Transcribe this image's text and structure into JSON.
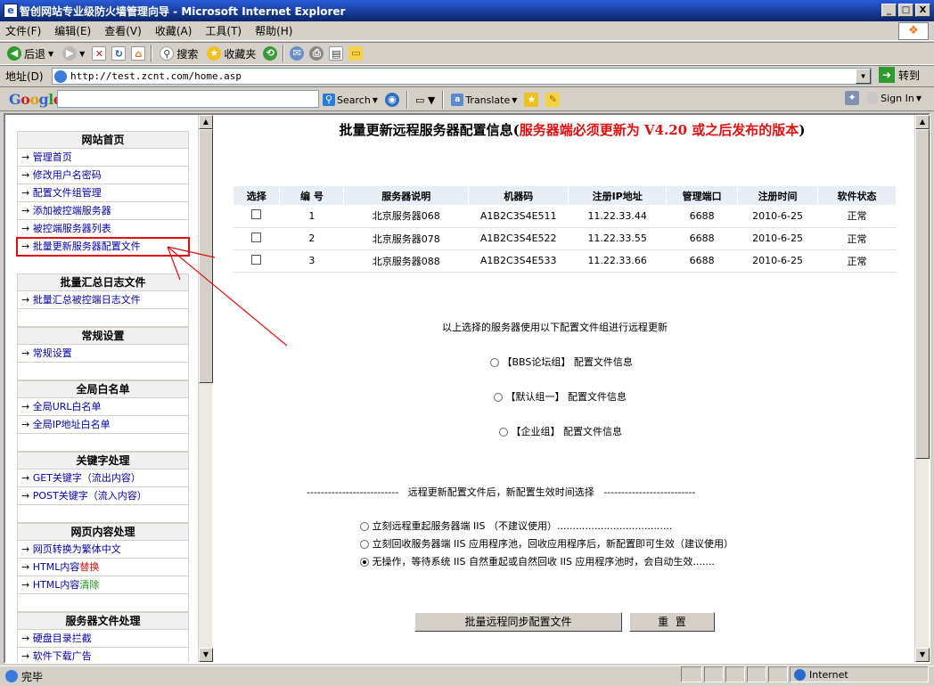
{
  "window": {
    "title": "智创网站专业级防火墙管理向导 - Microsoft Internet Explorer",
    "min": "_",
    "max": "□",
    "close": "X"
  },
  "menu": [
    "文件(F)",
    "编辑(E)",
    "查看(V)",
    "收藏(A)",
    "工具(T)",
    "帮助(H)"
  ],
  "toolbar": {
    "back": "后退",
    "search": "搜索",
    "favorites": "收藏夹"
  },
  "address": {
    "label": "地址(D)",
    "url": "http://test.zcnt.com/home.asp",
    "go": "转到"
  },
  "google": {
    "logo": "Google",
    "search": "Search",
    "translate": "Translate",
    "signin": "Sign In"
  },
  "sidebar": {
    "sections": [
      {
        "title": "网站首页",
        "items": [
          "管理首页",
          "修改用户名密码",
          "配置文件组管理",
          "添加被控端服务器",
          "被控端服务器列表",
          "批量更新服务器配置文件"
        ]
      },
      {
        "title": "批量汇总日志文件",
        "items": [
          "批量汇总被控端日志文件"
        ]
      },
      {
        "title": "常规设置",
        "items": [
          "常规设置"
        ]
      },
      {
        "title": "全局白名单",
        "items": [
          "全局URL白名单",
          "全局IP地址白名单"
        ]
      },
      {
        "title": "关键字处理",
        "items": [
          "GET关键字（流出内容）",
          "POST关键字（流入内容）"
        ]
      },
      {
        "title": "网页内容处理",
        "items": [
          "网页转换为繁体中文",
          "HTML内容替换",
          "HTML内容清除"
        ]
      },
      {
        "title": "服务器文件处理",
        "items": [
          "硬盘目录拦截",
          "软件下载广告"
        ]
      }
    ],
    "arrow": "→",
    "accent_replace": "#e01010",
    "accent_clear": "#1a8f1a"
  },
  "main": {
    "title_prefix": "批量更新远程服务器配置信息(",
    "title_red": "服务器端必须更新为 V4.20 或之后发布的版本",
    "title_suffix": ")",
    "columns": [
      "选择",
      "编 号",
      "服务器说明",
      "机器码",
      "注册IP地址",
      "管理端口",
      "注册时间",
      "软件状态"
    ],
    "rows": [
      {
        "id": "1",
        "desc": "北京服务器068",
        "code": "A1B2C3S4E511",
        "ip": "11.22.33.44",
        "port": "6688",
        "time": "2010-6-25",
        "status": "正常"
      },
      {
        "id": "2",
        "desc": "北京服务器078",
        "code": "A1B2C3S4E522",
        "ip": "11.22.33.55",
        "port": "6688",
        "time": "2010-6-25",
        "status": "正常"
      },
      {
        "id": "3",
        "desc": "北京服务器088",
        "code": "A1B2C3S4E533",
        "ip": "11.22.33.66",
        "port": "6688",
        "time": "2010-6-25",
        "status": "正常"
      }
    ],
    "instruction": "以上选择的服务器使用以下配置文件组进行远程更新",
    "groups": [
      "【BBS论坛组】 配置文件信息",
      "【默认组一】 配置文件信息",
      "【企业组】 配置文件信息"
    ],
    "divider_text": "远程更新配置文件后，新配置生效时间选择",
    "divider_dashes": "--------------------------",
    "options": [
      "立刻远程重起服务器端 IIS （不建议使用）.....................................",
      "立刻回收服务器端 IIS 应用程序池，回收应用程序后，新配置即可生效（建议使用）",
      "无操作，等待系统 IIS 自然重起或自然回收 IIS 应用程序池时，会自动生效......."
    ],
    "selected_option": 2,
    "btn_sync": "批量远程同步配置文件",
    "btn_reset": "重  置"
  },
  "status": {
    "text": "完毕",
    "zone": "Internet"
  }
}
